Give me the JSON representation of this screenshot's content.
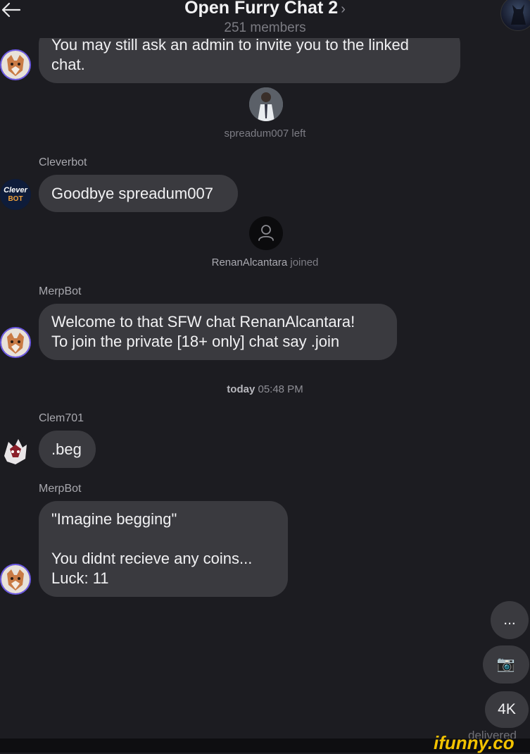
{
  "header": {
    "title": "Open Furry Chat 2",
    "chevron": "›",
    "members": "251 members"
  },
  "messages": {
    "m0": {
      "text": "You may still ask an admin to invite you to the linked\nchat."
    },
    "sys1": {
      "user": "spreadum007",
      "action": " left"
    },
    "m1": {
      "sender": "Cleverbot",
      "text": "Goodbye spreadum007",
      "avatar_text": "Clever\nBOT"
    },
    "sys2": {
      "user": "RenanAlcantara",
      "action": " joined"
    },
    "m2": {
      "sender": "MerpBot",
      "text": "Welcome to that SFW chat RenanAlcantara!\nTo join the private [18+ only] chat say .join"
    },
    "sep": {
      "day": "today",
      "time": " 05:48 PM"
    },
    "m3": {
      "sender": "Clem701",
      "text": ".beg"
    },
    "m4": {
      "sender": "MerpBot",
      "text": "\"Imagine begging\"\n\nYou didnt recieve any coins...\nLuck: 11"
    }
  },
  "actions": {
    "more": "...",
    "camera_glyph": "📷",
    "quality": "4K"
  },
  "status": "delivered",
  "watermark": "ifunny.co",
  "colors": {
    "background": "#1c1c21",
    "bubble": "#3a3a3f",
    "avatar_ring": "#6d5ae6",
    "watermark": "#f2c200"
  }
}
